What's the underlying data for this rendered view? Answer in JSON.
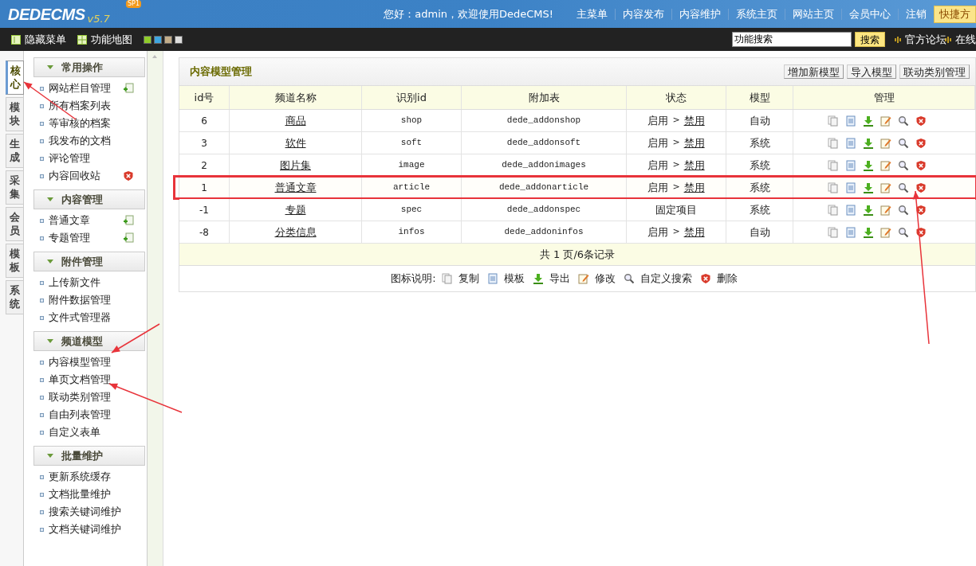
{
  "logo": {
    "name": "DEDECMS",
    "version": "v5.7",
    "badge": "SP1"
  },
  "top_bar": {
    "greeting": "您好：admin，欢迎使用DedeCMS!",
    "nav": [
      "主菜单",
      "内容发布",
      "内容维护",
      "系统主页",
      "网站主页",
      "会员中心",
      "注销"
    ],
    "shortcut": "快捷方"
  },
  "tool_bar": {
    "links": [
      {
        "kind": "hide",
        "label": "隐藏菜单"
      },
      {
        "kind": "map",
        "label": "功能地图"
      }
    ],
    "swatches": [
      {
        "color": "#8fcc2a"
      },
      {
        "color": "#3fa6e0"
      },
      {
        "color": "#c2ad8a"
      },
      {
        "color": "#dddddd"
      }
    ],
    "search": {
      "value": "功能搜索",
      "button": "搜索"
    },
    "right_links": [
      "官方论坛",
      "在线"
    ]
  },
  "side_tabs": [
    {
      "label": "核心",
      "selected": true
    },
    {
      "label": "模块",
      "selected": false
    },
    {
      "label": "生成",
      "selected": false
    },
    {
      "label": "采集",
      "selected": false
    },
    {
      "label": "会员",
      "selected": false
    },
    {
      "label": "模板",
      "selected": false
    },
    {
      "label": "系统",
      "selected": false
    }
  ],
  "sidebar": [
    {
      "title": "常用操作",
      "items": [
        {
          "label": "网站栏目管理",
          "kind": "add"
        },
        {
          "label": "所有档案列表"
        },
        {
          "label": "等审核的档案"
        },
        {
          "label": "我发布的文档"
        },
        {
          "label": "评论管理"
        },
        {
          "label": "内容回收站",
          "kind": "delete"
        }
      ]
    },
    {
      "title": "内容管理",
      "items": [
        {
          "label": "普通文章",
          "kind": "add"
        },
        {
          "label": "专题管理",
          "kind": "add"
        }
      ]
    },
    {
      "title": "附件管理",
      "items": [
        {
          "label": "上传新文件"
        },
        {
          "label": "附件数据管理"
        },
        {
          "label": "文件式管理器"
        }
      ]
    },
    {
      "title": "频道模型",
      "items": [
        {
          "label": "内容模型管理"
        },
        {
          "label": "单页文档管理"
        },
        {
          "label": "联动类别管理"
        },
        {
          "label": "自由列表管理"
        },
        {
          "label": "自定义表单"
        }
      ]
    },
    {
      "title": "批量维护",
      "items": [
        {
          "label": "更新系统缓存"
        },
        {
          "label": "文档批量维护"
        },
        {
          "label": "搜索关键词维护"
        },
        {
          "label": "文档关键词维护"
        }
      ]
    }
  ],
  "panel": {
    "title": "内容模型管理",
    "buttons": [
      "增加新模型",
      "导入模型",
      "联动类别管理"
    ],
    "columns": [
      "id号",
      "频道名称",
      "识别id",
      "附加表",
      "状态",
      "模型",
      "管理"
    ],
    "rows": [
      {
        "id": "6",
        "name": "商品",
        "nid": "shop",
        "table": "dede_addonshop",
        "status": {
          "kind": "toggle",
          "on": "启用",
          "sep": ">",
          "off": "禁用"
        },
        "model": "自动",
        "highlighted": false
      },
      {
        "id": "3",
        "name": "软件",
        "nid": "soft",
        "table": "dede_addonsoft",
        "status": {
          "kind": "toggle",
          "on": "启用",
          "sep": ">",
          "off": "禁用"
        },
        "model": "系统",
        "highlighted": false
      },
      {
        "id": "2",
        "name": "图片集",
        "nid": "image",
        "table": "dede_addonimages",
        "status": {
          "kind": "toggle",
          "on": "启用",
          "sep": ">",
          "off": "禁用"
        },
        "model": "系统",
        "highlighted": false
      },
      {
        "id": "1",
        "name": "普通文章",
        "nid": "article",
        "table": "dede_addonarticle",
        "status": {
          "kind": "toggle",
          "on": "启用",
          "sep": ">",
          "off": "禁用"
        },
        "model": "系统",
        "highlighted": true
      },
      {
        "id": "-1",
        "name": "专题",
        "nid": "spec",
        "table": "dede_addonspec",
        "status": {
          "kind": "fixed",
          "text": "固定项目"
        },
        "model": "系统",
        "highlighted": false
      },
      {
        "id": "-8",
        "name": "分类信息",
        "nid": "infos",
        "table": "dede_addoninfos",
        "status": {
          "kind": "toggle",
          "on": "启用",
          "sep": ">",
          "off": "禁用"
        },
        "model": "自动",
        "highlighted": false
      }
    ],
    "pager": "共 1 页/6条记录",
    "legend": {
      "label": "图标说明:",
      "items": [
        {
          "kind": "copy",
          "label": "复制"
        },
        {
          "kind": "template",
          "label": "模板"
        },
        {
          "kind": "export",
          "label": "导出"
        },
        {
          "kind": "edit",
          "label": "修改"
        },
        {
          "kind": "search",
          "label": "自定义搜索"
        },
        {
          "kind": "delete",
          "label": "删除"
        }
      ]
    }
  }
}
